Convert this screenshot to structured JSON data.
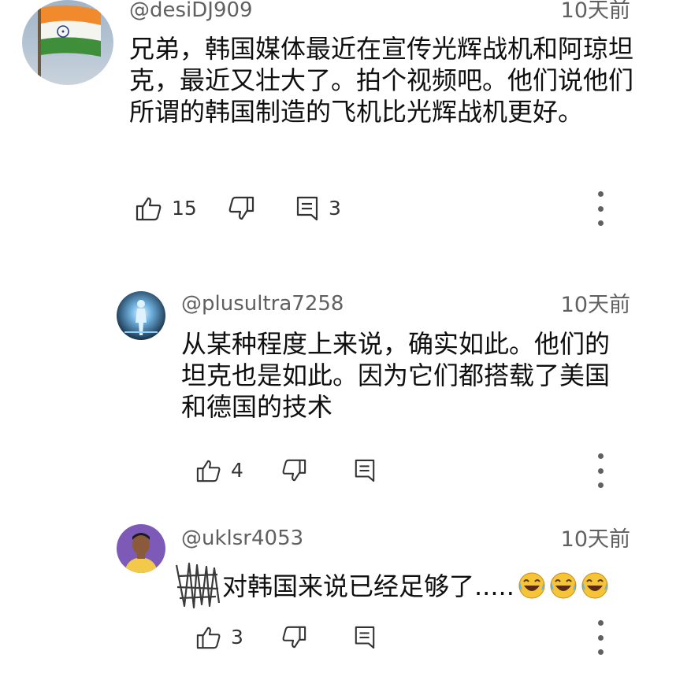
{
  "comments": [
    {
      "handle": "@desiDJ909",
      "time": "10天前",
      "text": "兄弟，韩国媒体最近在宣传光辉战机和阿琼坦克，最近又壮大了。拍个视频吧。他们说他们所谓的韩国制造的飞机比光辉战机更好。",
      "likes": "15",
      "replies": "3",
      "avatar_icon": "india-flag-avatar"
    },
    {
      "handle": "@plusultra7258",
      "time": "10天前",
      "text": "从某种程度上来说，确实如此。他们的坦克也是如此。因为它们都搭载了美国和德国的技术",
      "likes": "4",
      "avatar_icon": "glowing-figure-avatar"
    },
    {
      "handle": "@uklsr4053",
      "time": "10天前",
      "text": "对韩国来说已经足够了.....",
      "likes": "3",
      "emojis": [
        "😂",
        "😂",
        "😂"
      ],
      "avatar_icon": "person-avatar"
    }
  ],
  "colors": {
    "secondary_text": "#606060",
    "primary_text": "#0f0f0f"
  }
}
